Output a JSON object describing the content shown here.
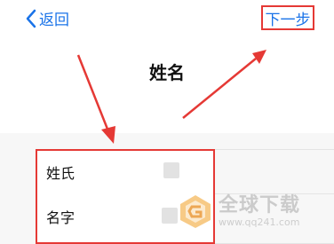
{
  "nav": {
    "back_label": "返回",
    "next_label": "下一步"
  },
  "page": {
    "title": "姓名"
  },
  "form": {
    "fields": [
      {
        "label": "姓氏"
      },
      {
        "label": "名字"
      }
    ]
  },
  "watermark": {
    "brand": "全球下载",
    "url": "www.qq241.com"
  },
  "colors": {
    "accent": "#1a73e8",
    "annotation": "#e53935"
  }
}
